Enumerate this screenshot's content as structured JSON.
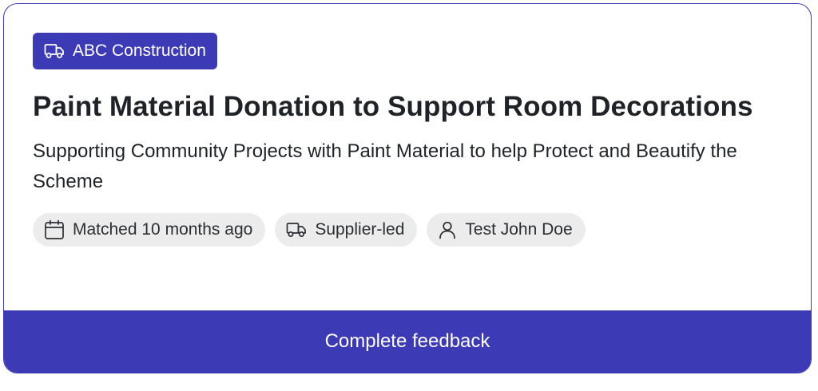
{
  "card": {
    "organization": "ABC Construction",
    "title": "Paint Material Donation to Support Room Decorations",
    "subtitle": "Supporting Community Projects with Paint Material to help Protect and Beautify the Scheme",
    "tags": [
      {
        "icon": "calendar-icon",
        "label": "Matched 10 months ago"
      },
      {
        "icon": "truck-icon",
        "label": "Supplier-led"
      },
      {
        "icon": "user-icon",
        "label": "Test John Doe"
      }
    ],
    "cta_label": "Complete feedback"
  },
  "colors": {
    "accent": "#3c3ab4",
    "tag_background": "#ececec",
    "text": "#1f2328"
  }
}
